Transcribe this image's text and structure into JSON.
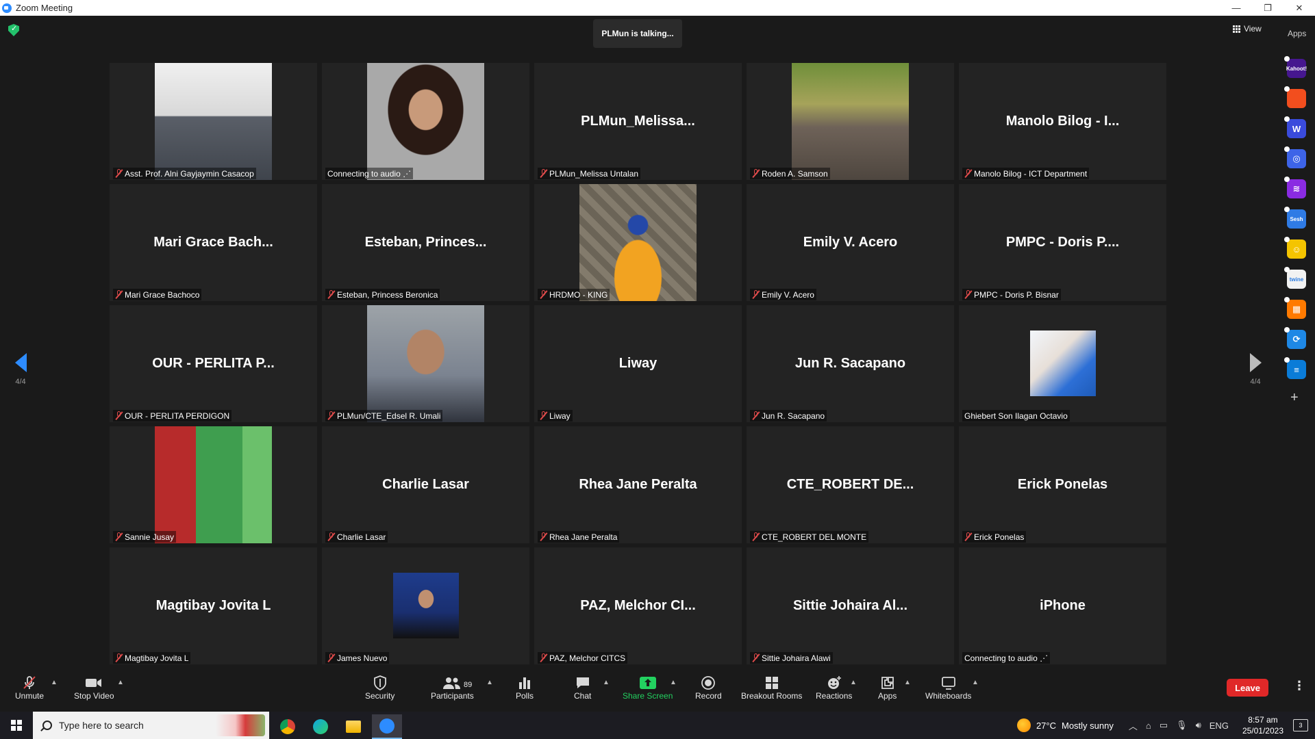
{
  "window": {
    "title": "Zoom Meeting",
    "minimize": "—",
    "restore": "❐",
    "close": "✕"
  },
  "meeting": {
    "talking_banner": "PLMun is talking...",
    "view_label": "View",
    "apps_label": "Apps",
    "page_indicator_left": "4/4",
    "page_indicator_right": "4/4"
  },
  "participants": [
    {
      "display": "",
      "label": "Asst. Prof. Alni Gayjaymin Casacop",
      "muted": true,
      "photo": "portrait-suit"
    },
    {
      "display": "",
      "label": "Connecting to audio ⋰",
      "muted": false,
      "photo": "portrait-woman"
    },
    {
      "display": "PLMun_Melissa...",
      "label": "PLMun_Melissa Untalan",
      "muted": true,
      "photo": ""
    },
    {
      "display": "",
      "label": "Roden A. Samson",
      "muted": true,
      "photo": "outdoor-rocks"
    },
    {
      "display": "Manolo Bilog - I...",
      "label": "Manolo Bilog - ICT Department",
      "muted": true,
      "photo": ""
    },
    {
      "display": "Mari Grace Bach...",
      "label": "Mari Grace Bachoco",
      "muted": true,
      "photo": ""
    },
    {
      "display": "Esteban, Princes...",
      "label": "Esteban, Princess Beronica",
      "muted": true,
      "photo": ""
    },
    {
      "display": "",
      "label": "HRDMO - KING",
      "muted": true,
      "photo": "stone-wall-beanie"
    },
    {
      "display": "Emily V. Acero",
      "label": "Emily V. Acero",
      "muted": true,
      "photo": ""
    },
    {
      "display": "PMPC - Doris P....",
      "label": "PMPC - Doris P. Bisnar",
      "muted": true,
      "photo": ""
    },
    {
      "display": "OUR - PERLITA P...",
      "label": "OUR - PERLITA PERDIGON",
      "muted": true,
      "photo": ""
    },
    {
      "display": "",
      "label": "PLMun/CTE_Edsel R. Umali",
      "muted": true,
      "photo": "portrait-toga"
    },
    {
      "display": "Liway",
      "label": "Liway",
      "muted": true,
      "photo": ""
    },
    {
      "display": "Jun  R. Sacapano",
      "label": "Jun  R. Sacapano",
      "muted": true,
      "photo": ""
    },
    {
      "display": "",
      "label": "Ghiebert Son Ilagan Octavio",
      "muted": false,
      "photo": "small-selfie"
    },
    {
      "display": "",
      "label": "Sannie Jusay",
      "muted": true,
      "photo": "couple-flowers"
    },
    {
      "display": "Charlie Lasar",
      "label": "Charlie Lasar",
      "muted": true,
      "photo": ""
    },
    {
      "display": "Rhea Jane Peralta",
      "label": "Rhea Jane Peralta",
      "muted": true,
      "photo": ""
    },
    {
      "display": "CTE_ROBERT DE...",
      "label": "CTE_ROBERT DEL MONTE",
      "muted": true,
      "photo": ""
    },
    {
      "display": "Erick Ponelas",
      "label": "Erick Ponelas",
      "muted": true,
      "photo": ""
    },
    {
      "display": "Magtibay Jovita L",
      "label": "Magtibay Jovita L",
      "muted": true,
      "photo": ""
    },
    {
      "display": "",
      "label": "James Nuevo",
      "muted": true,
      "photo": "small-graduation"
    },
    {
      "display": "PAZ, Melchor CI...",
      "label": "PAZ, Melchor CITCS",
      "muted": true,
      "photo": ""
    },
    {
      "display": "Sittie Johaira Al...",
      "label": "Sittie Johaira Alawi",
      "muted": true,
      "photo": ""
    },
    {
      "display": "iPhone",
      "label": "Connecting to audio ⋰",
      "muted": false,
      "photo": ""
    }
  ],
  "apps_rail": [
    {
      "icon": "kahoot-icon",
      "text": "Kahoot!",
      "color": "#46178f"
    },
    {
      "icon": "red-app-icon",
      "text": "",
      "color": "#f24e1e"
    },
    {
      "icon": "wordwall-icon",
      "text": "W",
      "color": "#3a4bdc"
    },
    {
      "icon": "blue-circle-app-icon",
      "text": "◎",
      "color": "#3d64e8"
    },
    {
      "icon": "purple-stripes-app-icon",
      "text": "≋",
      "color": "#8a2be2"
    },
    {
      "icon": "sesh-icon",
      "text": "Sesh",
      "color": "#2f7be5"
    },
    {
      "icon": "emoji-app-icon",
      "text": "☺",
      "color": "#f4c400"
    },
    {
      "icon": "twine-icon",
      "text": "twine",
      "color": "#f2f2f2"
    },
    {
      "icon": "grid-colors-app-icon",
      "text": "▦",
      "color": "#ff7a00"
    },
    {
      "icon": "sync-app-icon",
      "text": "⟳",
      "color": "#1e88e5"
    },
    {
      "icon": "stack-app-icon",
      "text": "≡",
      "color": "#0a7cd8"
    }
  ],
  "toolbar": {
    "unmute": "Unmute",
    "stop_video": "Stop Video",
    "security": "Security",
    "participants": "Participants",
    "participants_count": "89",
    "polls": "Polls",
    "chat": "Chat",
    "share_screen": "Share Screen",
    "record": "Record",
    "breakout_rooms": "Breakout Rooms",
    "reactions": "Reactions",
    "apps": "Apps",
    "whiteboards": "Whiteboards",
    "leave": "Leave",
    "more": "⋮"
  },
  "taskbar": {
    "search_placeholder": "Type here to search",
    "temperature": "27°C",
    "weather": "Mostly sunny",
    "language": "ENG",
    "time": "8:57 am",
    "date": "25/01/2023",
    "notification_count": "3"
  },
  "colors": {
    "accent": "#2d8cff",
    "share_green": "#23d160",
    "leave_red": "#e02828",
    "muted_red": "#e04b4b",
    "tile_bg": "#232323"
  }
}
